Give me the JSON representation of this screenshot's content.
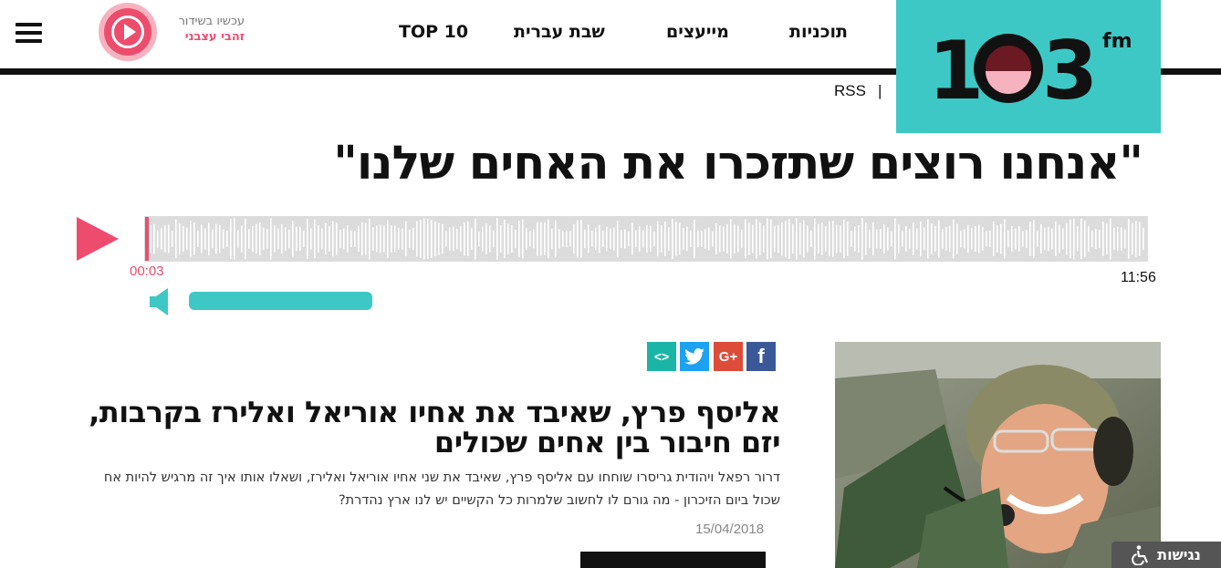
{
  "header": {
    "menu_icon": "hamburger-menu-icon",
    "live_now_label": "עכשיו בשידור",
    "live_show_name": "זהבי עצבני",
    "nav": [
      "TOP 10",
      "שבת עברית",
      "מייעצים",
      "תוכניות"
    ],
    "logo_text": "103",
    "logo_suffix": "fm",
    "rss_label": "RSS",
    "rss_separator": "|"
  },
  "page": {
    "title": "\"אנחנו רוצים שתזכרו את האחים שלנו\""
  },
  "player": {
    "current_time": "00:03",
    "total_time": "11:56",
    "play_icon": "play-icon",
    "volume_icon": "speaker-icon",
    "volume_level": 1.0,
    "colors": {
      "accent": "#ee4c6d",
      "volume": "#3ec8c5",
      "wave": "#dcdcdc"
    }
  },
  "article": {
    "share_icons": [
      "facebook-icon",
      "google-plus-icon",
      "twitter-icon",
      "embed-icon"
    ],
    "share_labels": {
      "fb": "f",
      "gp": "G+",
      "em": "<>"
    },
    "headline": "אליסף פרץ, שאיבד את אחיו אוריאל ואלירז בקרבות, יזם חיבור בין אחים שכולים",
    "summary": "דרור רפאל ויהודית גריסרו שוחחו עם אליסף פרץ, שאיבד את שני אחיו אוריאל ואלירז, ושאלו אותו איך זה מרגיש להיות אח שכול ביום הזיכרון - מה גורם לו לחשוב שלמרות כל הקשיים יש לנו ארץ נהדרת?",
    "date": "15/04/2018"
  },
  "accessibility": {
    "label": "נגישות",
    "icon": "wheelchair-icon"
  }
}
